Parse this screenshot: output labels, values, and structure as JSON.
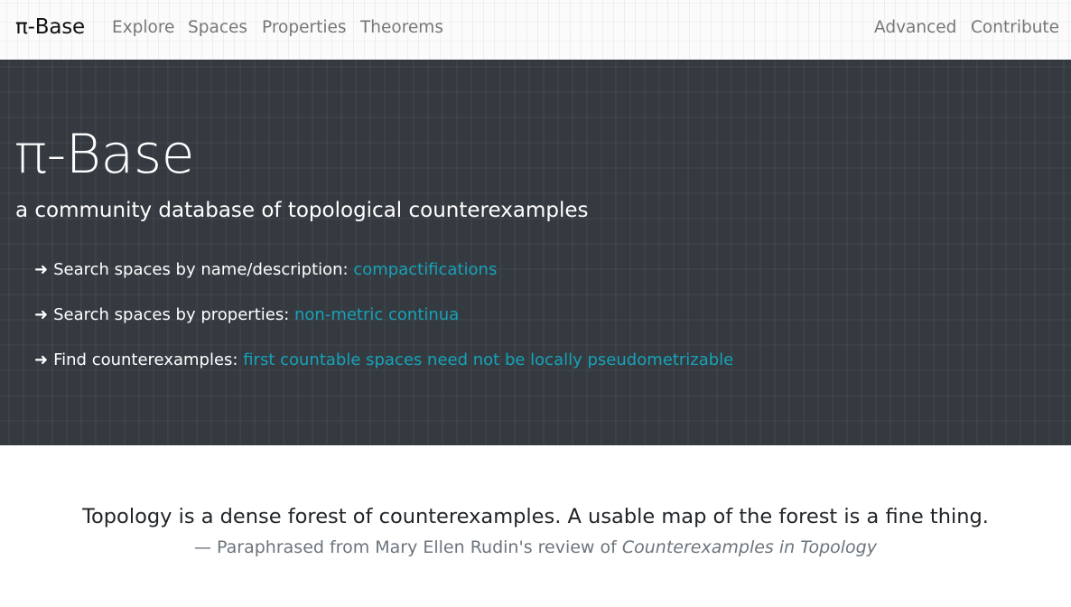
{
  "navbar": {
    "brand": "π-Base",
    "links": [
      "Explore",
      "Spaces",
      "Properties",
      "Theorems"
    ],
    "right_links": [
      "Advanced",
      "Contribute"
    ]
  },
  "hero": {
    "title": "π-Base",
    "subtitle": "a community database of topological counterexamples",
    "searches": [
      {
        "arrow": "➜",
        "label": "Search spaces by name/description: ",
        "link": "compactifications"
      },
      {
        "arrow": "➜",
        "label": "Search spaces by properties: ",
        "link": "non-metric continua"
      },
      {
        "arrow": "➜",
        "label": "Find counterexamples: ",
        "link": "first countable spaces need not be locally pseudometrizable"
      }
    ]
  },
  "quote": {
    "text": "Topology is a dense forest of counterexamples. A usable map of the forest is a fine thing.",
    "attribution_prefix": "— Paraphrased from Mary Ellen Rudin's review of ",
    "attribution_title": "Counterexamples in Topology"
  },
  "colors": {
    "hero_background": "#343a40",
    "link_accent": "#17a2b8",
    "nav_text": "#777777"
  }
}
